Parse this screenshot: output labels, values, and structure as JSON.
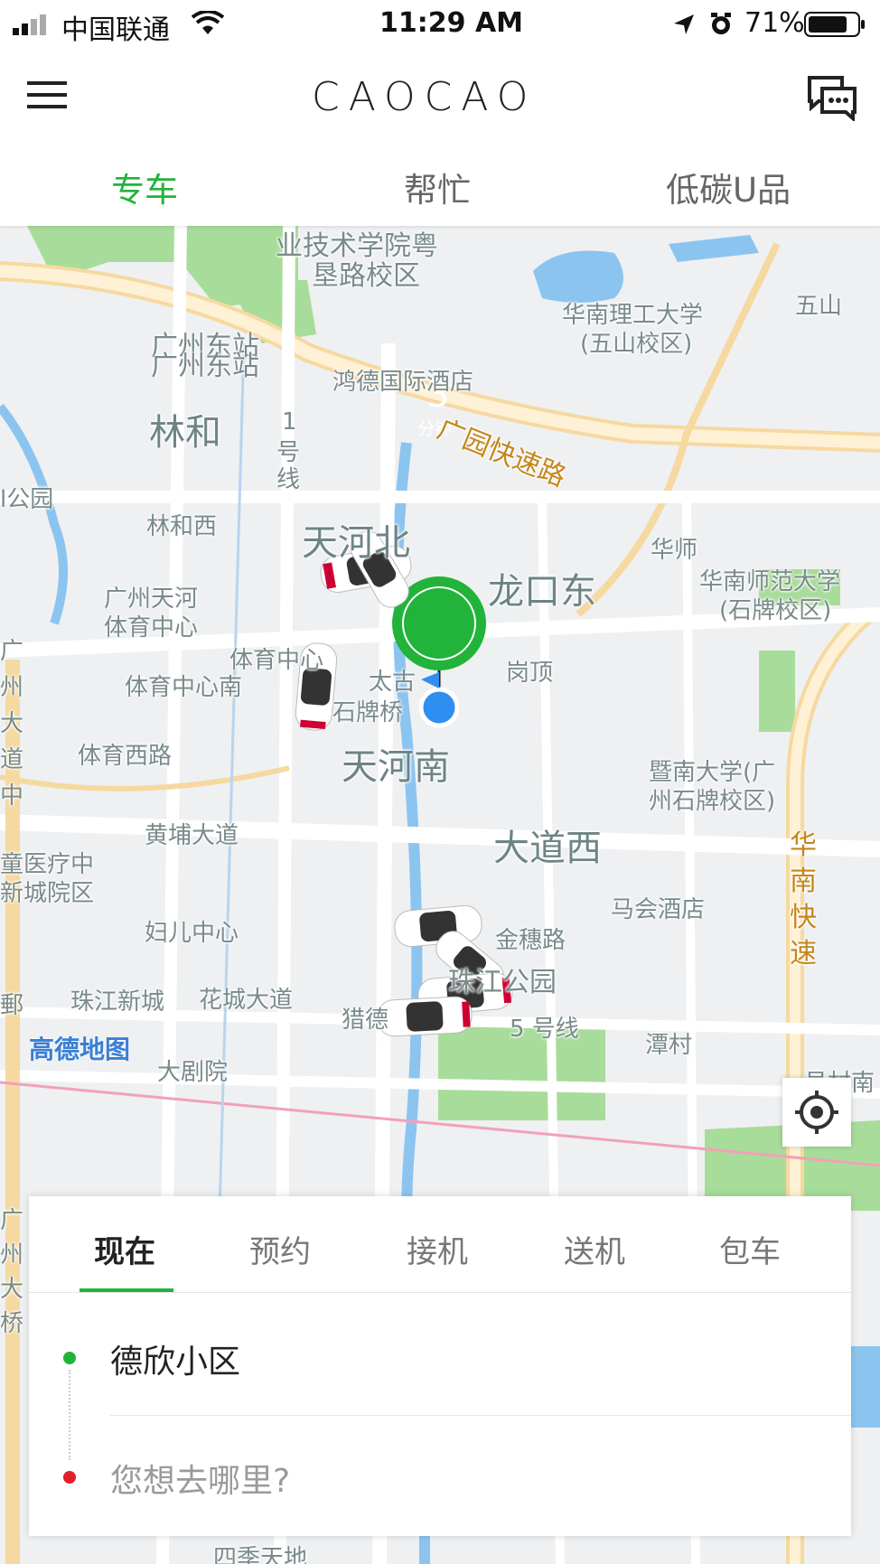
{
  "status_bar": {
    "carrier": "中国联通",
    "time": "11:29 AM",
    "battery": "71%"
  },
  "header": {
    "logo": "CAOCAO"
  },
  "service_tabs": [
    {
      "label": "专车"
    },
    {
      "label": "帮忙"
    },
    {
      "label": "低碳U品"
    }
  ],
  "map": {
    "eta": {
      "value": "3",
      "unit": "分钟"
    },
    "attribution": "高德地图",
    "labels": {
      "t1": "业技术学院粤",
      "t2": "垦路校区",
      "t3": "广州东站",
      "t4": "广州东站",
      "t5": "鸿德国际酒店",
      "t6": "华南理工大学",
      "t7": "(五山校区)",
      "t8": "五山",
      "t9": "广园快速路",
      "t10": "林和",
      "t11": "1",
      "t12": "号",
      "t13": "线",
      "t14": "l公园",
      "t15": "林和西",
      "t16": "天河北",
      "t17": "龙口东",
      "t18": "华师",
      "t19": "华南师范大学",
      "t20": "(石牌校区)",
      "t21": "广州天河",
      "t22": "体育中心",
      "t23": "体育中心",
      "t24": "体育中心南",
      "t25": "太古",
      "t26": "石牌桥",
      "t27": "岗顶",
      "t28": "体育西路",
      "t29": "天河南",
      "t30": "暨南大学(广",
      "t31": "州石牌校区)",
      "t32": "黄埔大道",
      "t33": "大道西",
      "t34": "童医疗中",
      "t35": "新城院区",
      "t36": "马会酒店",
      "t37": "华",
      "t38": "南",
      "t39": "快",
      "t40": "速",
      "t41": "妇儿中心",
      "t42": "金穗路",
      "t43": "珠江公园",
      "t44": "珠江新城",
      "t45": "花城大道",
      "t46": "猎德",
      "t47": "5 号线",
      "t48": "潭村",
      "t49": "大剧院",
      "t50": "员村南",
      "t51": "广",
      "t52": "州",
      "t53": "大",
      "t54": "道",
      "t55": "中",
      "t56": "广",
      "t57": "州",
      "t58": "大",
      "t59": "桥",
      "t60": "酒店",
      "t61": "四季天地",
      "t62": "郵"
    }
  },
  "order_panel": {
    "tabs": [
      {
        "label": "现在"
      },
      {
        "label": "预约"
      },
      {
        "label": "接机"
      },
      {
        "label": "送机"
      },
      {
        "label": "包车"
      }
    ],
    "pickup": "德欣小区",
    "destination_placeholder": "您想去哪里?",
    "colors": {
      "pickup_dot": "#22b33a",
      "destination_dot": "#e0202a"
    }
  },
  "colors": {
    "accent": "#22b33a",
    "user_location": "#2f8ff0"
  },
  "icons": [
    "menu-icon",
    "chat-icon",
    "signal-icon",
    "wifi-icon",
    "location-arrow-icon",
    "alarm-icon",
    "battery-icon",
    "locate-icon",
    "car-icon",
    "location-dot-icon"
  ]
}
